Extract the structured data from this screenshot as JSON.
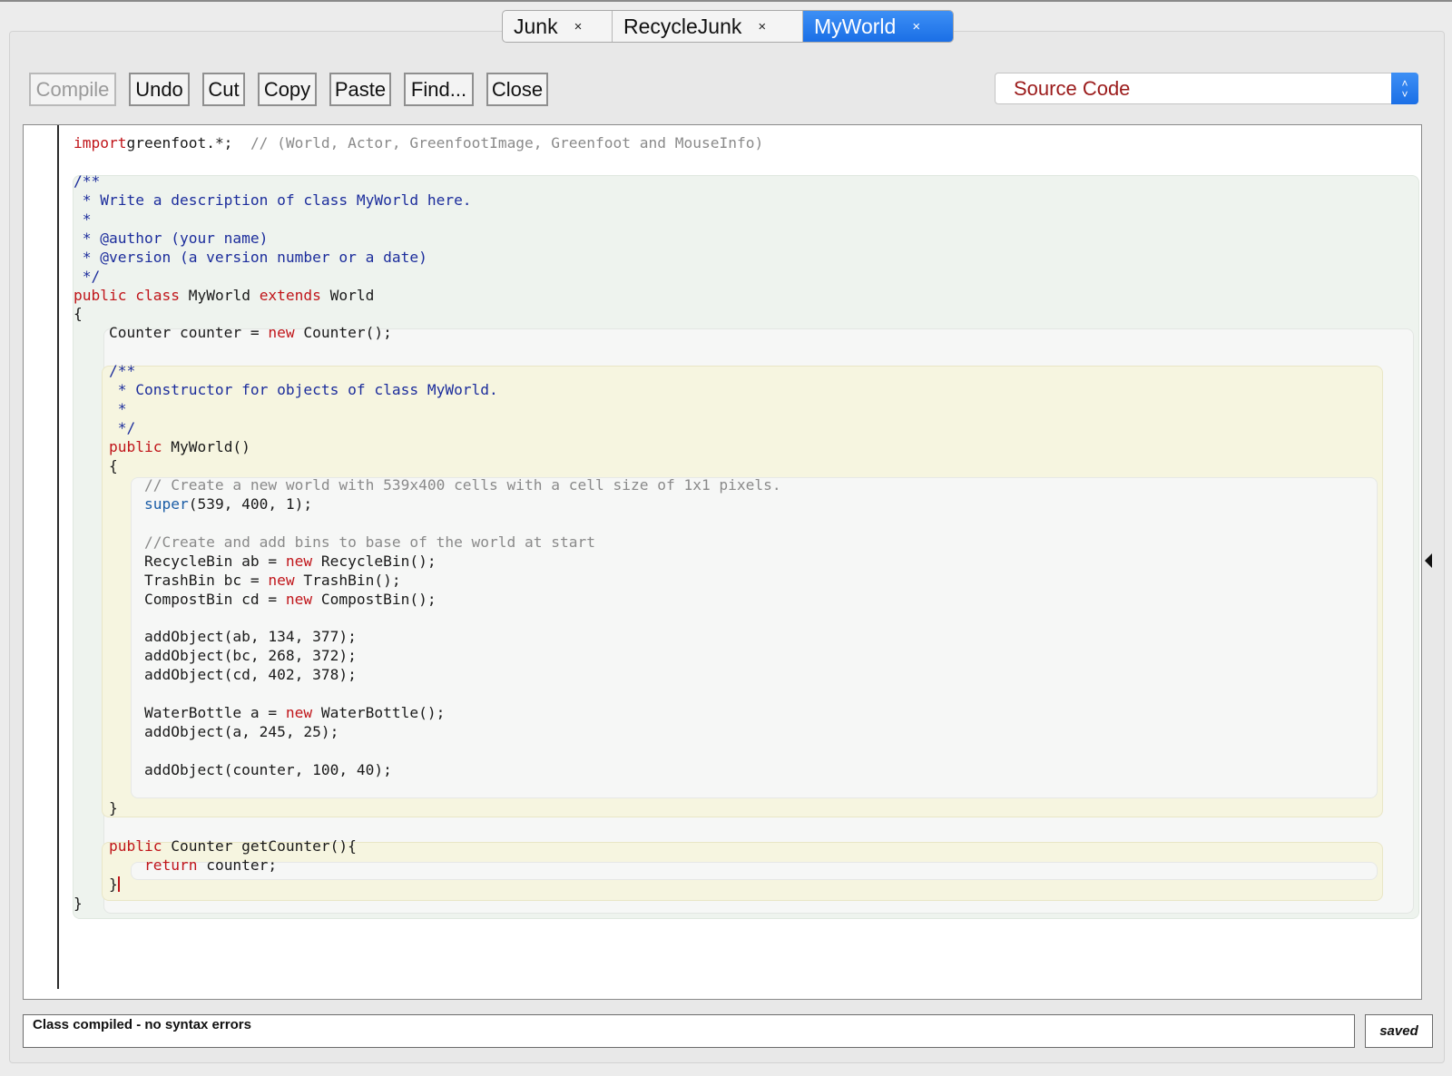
{
  "tabs": [
    {
      "label": "Junk",
      "active": false
    },
    {
      "label": "RecycleJunk",
      "active": false
    },
    {
      "label": "MyWorld",
      "active": true
    }
  ],
  "tab_close_glyph": "×",
  "toolbar": {
    "compile": "Compile",
    "undo": "Undo",
    "cut": "Cut",
    "copy": "Copy",
    "paste": "Paste",
    "find": "Find...",
    "close": "Close"
  },
  "view_select": {
    "value": "Source Code"
  },
  "code_lines": [
    [
      [
        "kw",
        "import"
      ],
      [
        "",
        "greenfoot.*;  "
      ],
      [
        "cm",
        "// (World, Actor, GreenfootImage, Greenfoot and MouseInfo)"
      ]
    ],
    [
      [
        "",
        ""
      ]
    ],
    [
      [
        "jd",
        "/**"
      ]
    ],
    [
      [
        "jd",
        " * Write a description of class MyWorld here."
      ]
    ],
    [
      [
        "jd",
        " * "
      ]
    ],
    [
      [
        "jd",
        " * @author (your name) "
      ]
    ],
    [
      [
        "jd",
        " * @version (a version number or a date)"
      ]
    ],
    [
      [
        "jd",
        " */"
      ]
    ],
    [
      [
        "kw",
        "public"
      ],
      [
        "",
        " "
      ],
      [
        "kw",
        "class"
      ],
      [
        "",
        " MyWorld "
      ],
      [
        "kw",
        "extends"
      ],
      [
        "",
        " World"
      ]
    ],
    [
      [
        "",
        "{"
      ]
    ],
    [
      [
        "",
        "    Counter counter = "
      ],
      [
        "kw",
        "new"
      ],
      [
        "",
        " Counter();"
      ]
    ],
    [
      [
        "",
        ""
      ]
    ],
    [
      [
        "jd",
        "    /**"
      ]
    ],
    [
      [
        "jd",
        "     * Constructor for objects of class MyWorld."
      ]
    ],
    [
      [
        "jd",
        "     * "
      ]
    ],
    [
      [
        "jd",
        "     */"
      ]
    ],
    [
      [
        "kw",
        "    public"
      ],
      [
        "",
        " MyWorld()"
      ]
    ],
    [
      [
        "",
        "    {    "
      ]
    ],
    [
      [
        "cm",
        "        // Create a new world with 539x400 cells with a cell size of 1x1 pixels."
      ]
    ],
    [
      [
        "kb",
        "        super"
      ],
      [
        "",
        "(539, 400, 1); "
      ]
    ],
    [
      [
        "",
        ""
      ]
    ],
    [
      [
        "cm",
        "        //Create and add bins to base of the world at start"
      ]
    ],
    [
      [
        "",
        "        RecycleBin ab = "
      ],
      [
        "kw",
        "new"
      ],
      [
        "",
        " RecycleBin();"
      ]
    ],
    [
      [
        "",
        "        TrashBin bc = "
      ],
      [
        "kw",
        "new"
      ],
      [
        "",
        " TrashBin();"
      ]
    ],
    [
      [
        "",
        "        CompostBin cd = "
      ],
      [
        "kw",
        "new"
      ],
      [
        "",
        " CompostBin();"
      ]
    ],
    [
      [
        "",
        ""
      ]
    ],
    [
      [
        "",
        "        addObject(ab, 134, 377);"
      ]
    ],
    [
      [
        "",
        "        addObject(bc, 268, 372);"
      ]
    ],
    [
      [
        "",
        "        addObject(cd, 402, 378);"
      ]
    ],
    [
      [
        "",
        ""
      ]
    ],
    [
      [
        "",
        "        WaterBottle a = "
      ],
      [
        "kw",
        "new"
      ],
      [
        "",
        " WaterBottle();"
      ]
    ],
    [
      [
        "",
        "        addObject(a, 245, 25);"
      ]
    ],
    [
      [
        "",
        ""
      ]
    ],
    [
      [
        "",
        "        addObject(counter, 100, 40);"
      ]
    ],
    [
      [
        "",
        ""
      ]
    ],
    [
      [
        "",
        "    }"
      ]
    ],
    [
      [
        "",
        ""
      ]
    ],
    [
      [
        "kw",
        "    public"
      ],
      [
        "",
        " Counter getCounter(){"
      ]
    ],
    [
      [
        "kw",
        "        return"
      ],
      [
        "",
        " counter;"
      ]
    ],
    [
      [
        "",
        "    }"
      ],
      [
        "caret",
        ""
      ]
    ],
    [
      [
        "",
        "}"
      ]
    ]
  ],
  "status": {
    "message": "Class compiled - no syntax errors",
    "saved": "saved"
  },
  "colors": {
    "keyword": "#c0151a",
    "javadoc": "#1c2d9c",
    "comment": "#8a8a8a",
    "accent": "#1b6fe6"
  }
}
